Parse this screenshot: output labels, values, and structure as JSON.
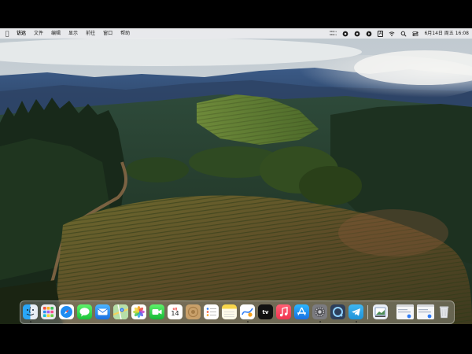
{
  "menubar": {
    "app_name": "访达",
    "items": [
      "文件",
      "编辑",
      "显示",
      "前往",
      "窗口",
      "帮助"
    ],
    "status": {
      "net_up": "0KB/s",
      "net_down": "0KB/s",
      "input_method": "A",
      "datetime": "6月14日 周五  16:08"
    }
  },
  "calendar_icon": {
    "month": "6月",
    "day": "14"
  },
  "tv_label": "tv",
  "colors": {
    "menubar": "#ebebee",
    "dock": "#c8c8cd"
  },
  "dock": {
    "apps": [
      "finder-icon",
      "launchpad-icon",
      "safari-icon",
      "messages-icon",
      "mail-icon",
      "maps-icon",
      "photos-icon",
      "facetime-icon",
      "calendar-icon",
      "system-app-icon",
      "reminders-icon",
      "notes-icon",
      "freeform-icon",
      "apple-tv-icon",
      "music-icon",
      "app-store-icon",
      "system-settings-icon",
      "quicktime-icon",
      "telegram-icon",
      "preview-icon",
      "window-thumbnail-icon",
      "window-thumbnail-icon",
      "trash-icon"
    ]
  }
}
